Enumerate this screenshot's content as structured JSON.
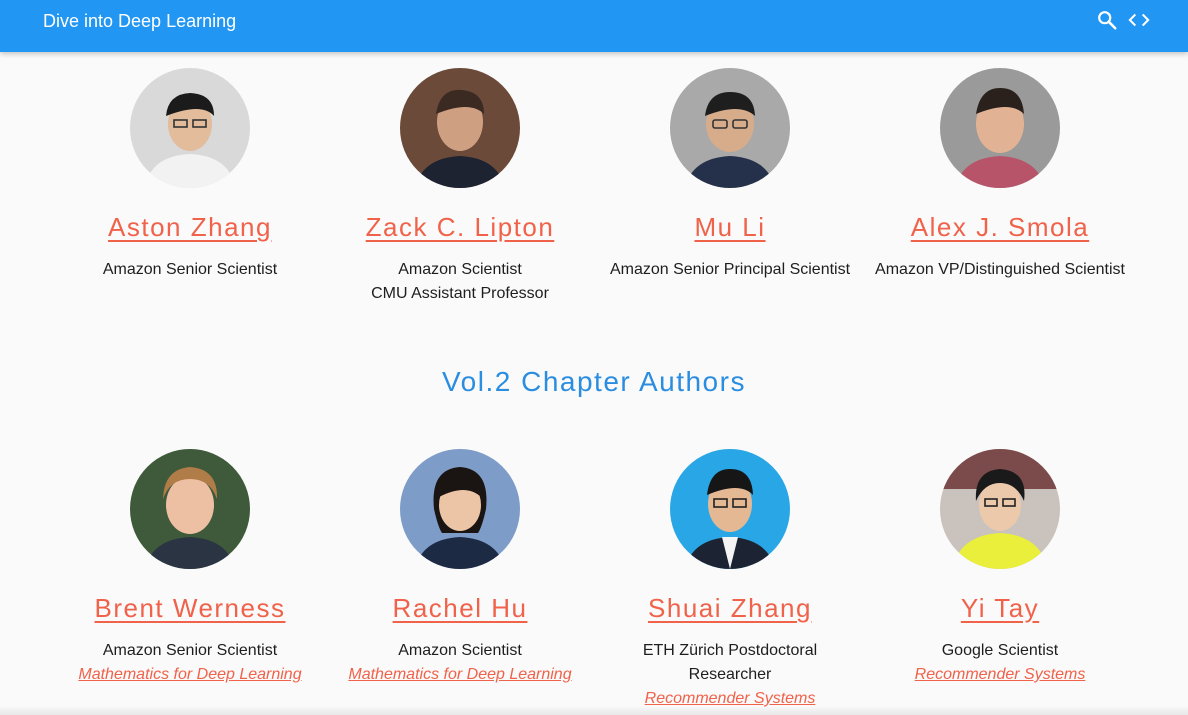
{
  "header": {
    "title": "Dive into Deep Learning"
  },
  "authors_row1": [
    {
      "name": "Aston Zhang",
      "roles": [
        "Amazon Senior Scientist"
      ]
    },
    {
      "name": "Zack C. Lipton",
      "roles": [
        "Amazon Scientist",
        "CMU Assistant Professor"
      ]
    },
    {
      "name": "Mu Li",
      "roles": [
        "Amazon Senior Principal Scientist"
      ]
    },
    {
      "name": "Alex J. Smola",
      "roles": [
        "Amazon VP/Distinguished Scientist"
      ]
    }
  ],
  "section": {
    "title": "Vol.2 Chapter Authors"
  },
  "authors_row2": [
    {
      "name": "Brent Werness",
      "roles": [
        "Amazon Senior Scientist"
      ],
      "topic": "Mathematics for Deep Learning"
    },
    {
      "name": "Rachel Hu",
      "roles": [
        "Amazon Scientist"
      ],
      "topic": "Mathematics for Deep Learning"
    },
    {
      "name": "Shuai Zhang",
      "roles": [
        "ETH Zürich Postdoctoral",
        "Researcher"
      ],
      "topic": "Recommender Systems"
    },
    {
      "name": "Yi Tay",
      "roles": [
        "Google Scientist"
      ],
      "topic": "Recommender Systems"
    }
  ],
  "colors": {
    "header": "#2196f3",
    "link": "#f0624a",
    "section_title": "#2b8de0"
  },
  "icons": {
    "search": "search-icon",
    "code": "code-icon"
  }
}
